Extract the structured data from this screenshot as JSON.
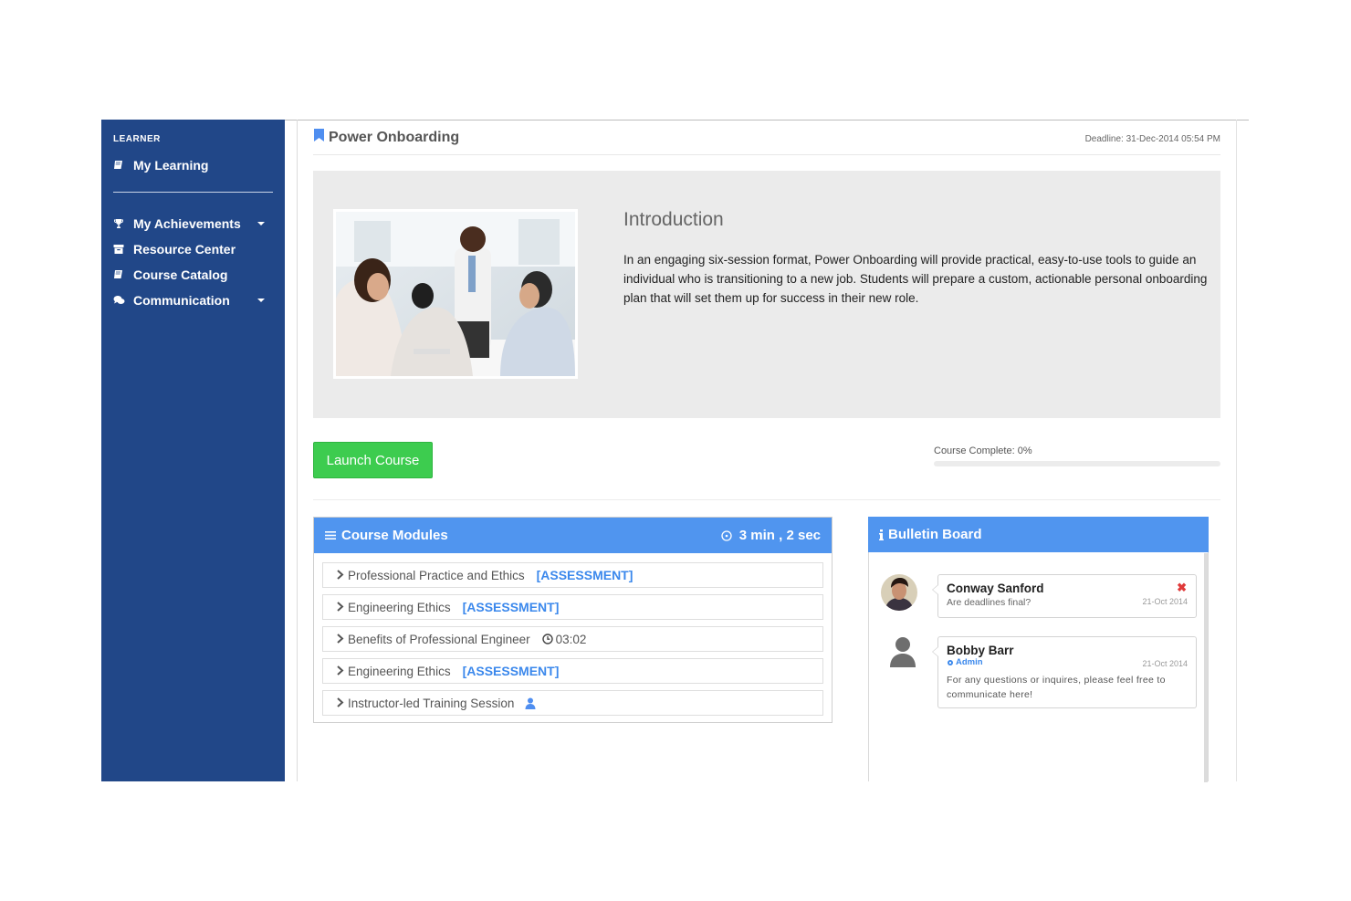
{
  "sidebar": {
    "section_label": "LEARNER",
    "items": [
      {
        "label": "My Learning",
        "icon": "book-icon"
      },
      {
        "label": "My Achievements",
        "icon": "trophy-icon"
      },
      {
        "label": "Resource Center",
        "icon": "archive-icon"
      },
      {
        "label": "Course Catalog",
        "icon": "book-icon"
      },
      {
        "label": "Communication",
        "icon": "chat-icon"
      }
    ]
  },
  "course": {
    "title": "Power Onboarding",
    "deadline": "Deadline: 31-Dec-2014 05:54 PM",
    "intro_title": "Introduction",
    "intro_text": "In an engaging six-session format, Power Onboarding will provide practical, easy-to-use tools to guide an individual who is transitioning to a new job. Students will prepare a custom, actionable personal onboarding plan that will set them up for success in their new role.",
    "launch_label": "Launch Course",
    "progress_label": "Course Complete: 0%",
    "progress_percent": 0
  },
  "modules": {
    "header": "Course Modules",
    "duration": "3 min , 2 sec",
    "items": [
      {
        "name": "Professional Practice and Ethics",
        "tag": "[ASSESSMENT]"
      },
      {
        "name": "Engineering Ethics",
        "tag": "[ASSESSMENT]"
      },
      {
        "name": "Benefits of Professional Engineer",
        "time": "03:02"
      },
      {
        "name": "Engineering Ethics",
        "tag": "[ASSESSMENT]"
      },
      {
        "name": "Instructor-led Training Session"
      }
    ]
  },
  "bulletin": {
    "header": "Bulletin Board",
    "messages": [
      {
        "name": "Conway Sanford",
        "text": "Are deadlines final?",
        "date": "21-Oct 2014"
      },
      {
        "name": "Bobby Barr",
        "role": "Admin",
        "date": "21-Oct 2014",
        "text": "For any questions or inquires, please feel free to communicate here!"
      }
    ]
  },
  "colors": {
    "sidebar_bg": "#214788",
    "panel_header": "#5095ef",
    "launch_button": "#3dcc4f",
    "assessment_tag": "#3b88ec",
    "close_icon": "#e03a3a"
  }
}
